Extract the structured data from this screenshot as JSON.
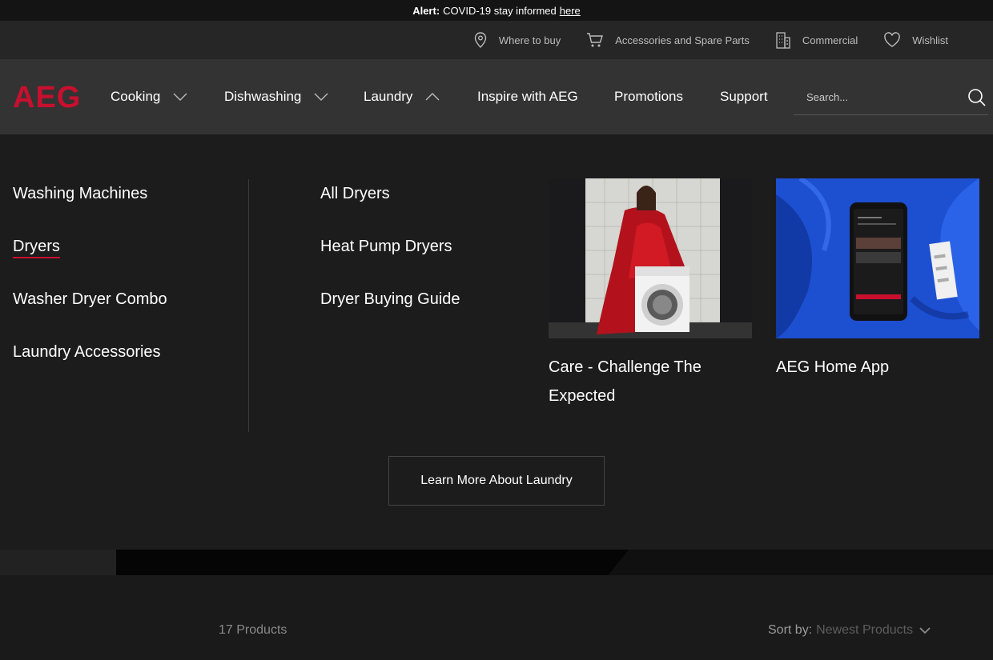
{
  "alert": {
    "prefix": "Alert:",
    "message": "COVID-19 stay informed",
    "link": "here"
  },
  "utility_nav": [
    {
      "label": "Where to buy",
      "icon": "location-pin-icon"
    },
    {
      "label": "Accessories and Spare Parts",
      "icon": "cart-icon"
    },
    {
      "label": "Commercial",
      "icon": "building-icon"
    },
    {
      "label": "Wishlist",
      "icon": "heart-icon"
    }
  ],
  "brand": {
    "logo": "AEG",
    "color": "#c8102e"
  },
  "main_nav": {
    "items": [
      {
        "label": "Cooking",
        "chevron": "down"
      },
      {
        "label": "Dishwashing",
        "chevron": "down"
      },
      {
        "label": "Laundry",
        "chevron": "up"
      },
      {
        "label": "Inspire with AEG"
      },
      {
        "label": "Promotions"
      },
      {
        "label": "Support"
      }
    ],
    "search_placeholder": "Search..."
  },
  "mega_menu": {
    "categories": [
      "Washing Machines",
      "Dryers",
      "Washer Dryer Combo",
      "Laundry Accessories"
    ],
    "active_category": "Dryers",
    "subcategories": [
      "All Dryers",
      "Heat Pump Dryers",
      "Dryer Buying Guide"
    ],
    "promos": [
      {
        "caption": "Care - Challenge The Expected"
      },
      {
        "caption": "AEG Home App"
      }
    ],
    "cta": "Learn More About Laundry"
  },
  "results": {
    "count": "17 Products",
    "sort_label": "Sort by:",
    "sort_value": "Newest Products"
  }
}
